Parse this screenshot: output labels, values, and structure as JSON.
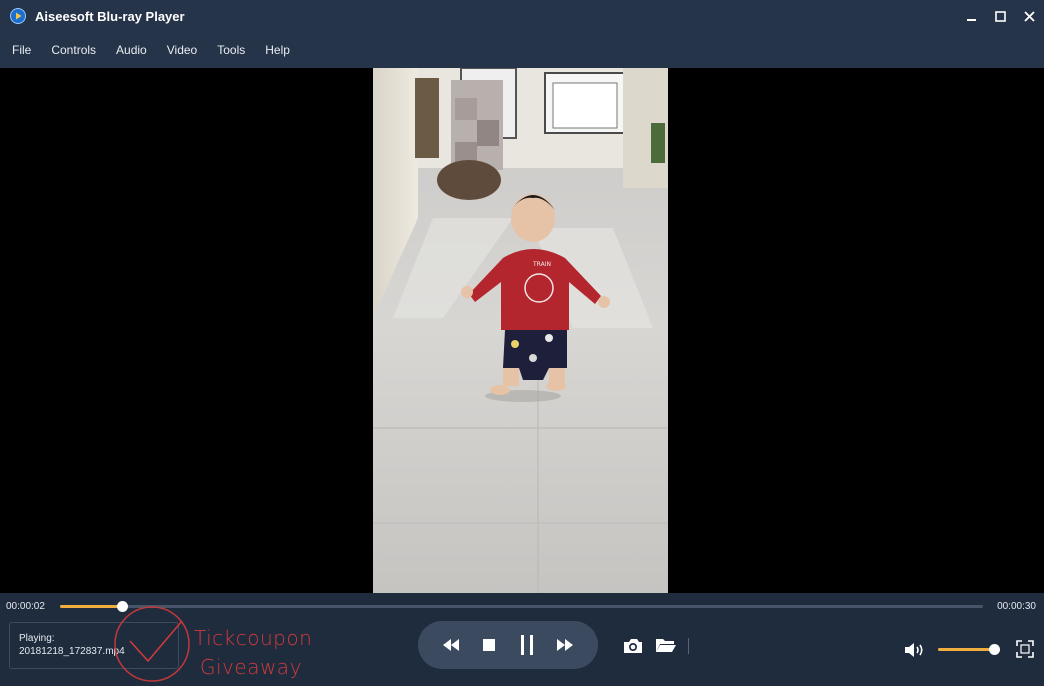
{
  "app": {
    "title": "Aiseesoft Blu-ray Player"
  },
  "menu": [
    "File",
    "Controls",
    "Audio",
    "Video",
    "Tools",
    "Help"
  ],
  "playback": {
    "current_time": "00:00:02",
    "total_time": "00:00:30",
    "progress": 0.067,
    "state": "playing"
  },
  "now_playing": {
    "label": "Playing:",
    "file": "20181218_172837.mp4"
  },
  "volume": {
    "level": 0.96
  },
  "watermark": {
    "line1": "Tickcoupon",
    "line2": "Giveaway"
  },
  "colors": {
    "accent": "#f0ae3e",
    "titlebar": "#263449",
    "controls_bg": "#1f2c3e",
    "watermark": "#d23a3a"
  },
  "icons": [
    "app-logo-icon",
    "minimize-icon",
    "maximize-icon",
    "close-icon",
    "rewind-icon",
    "stop-icon",
    "pause-icon",
    "fast-forward-icon",
    "camera-icon",
    "folder-icon",
    "volume-icon",
    "fullscreen-icon"
  ]
}
